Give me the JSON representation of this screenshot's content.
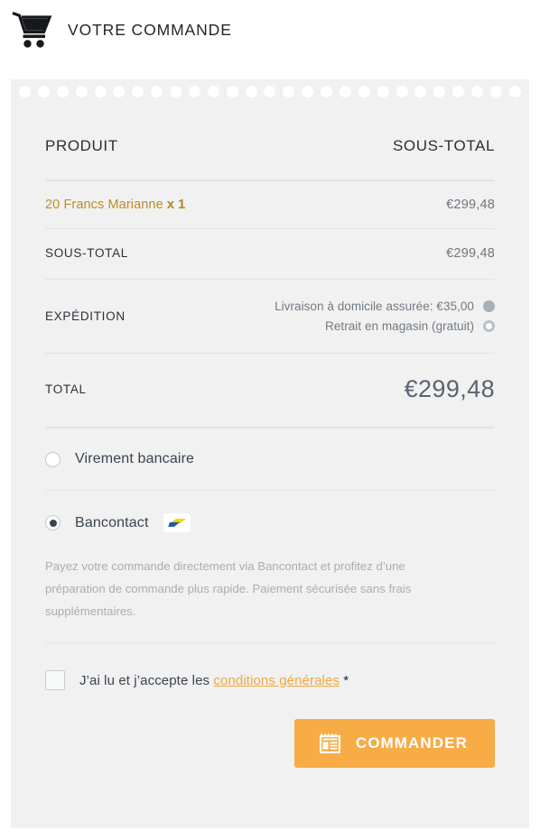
{
  "header": {
    "title": "VOTRE COMMANDE",
    "cart_icon": "shopping-cart-icon"
  },
  "order_table": {
    "columns": {
      "product": "PRODUIT",
      "subtotal": "SOUS-TOTAL"
    },
    "items": [
      {
        "name": "20 Francs Marianne",
        "quantity_label": "x 1",
        "price": "€299,48"
      }
    ],
    "subtotal": {
      "label": "SOUS-TOTAL",
      "value": "€299,48"
    },
    "shipping": {
      "label": "EXPÉDITION",
      "options": [
        {
          "label": "Livraison à domicile assurée: €35,00",
          "selected": true
        },
        {
          "label": "Retrait en magasin (gratuit)",
          "selected": false
        }
      ]
    },
    "total": {
      "label": "TOTAL",
      "value": "€299,48"
    }
  },
  "payment": {
    "methods": [
      {
        "label": "Virement bancaire",
        "selected": false,
        "has_logo": false,
        "description": ""
      },
      {
        "label": "Bancontact",
        "selected": true,
        "has_logo": true,
        "logo_name": "bancontact-logo",
        "description": "Payez votre commande directement via Bancontact et profitez d’une préparation de commande plus rapide. Paiement sécurisée sans frais supplémentaires."
      }
    ]
  },
  "terms": {
    "text_before": "J’ai lu et j’accepte les",
    "link": "conditions générales",
    "required_mark": "*",
    "checked": false
  },
  "order_button": {
    "label": "COMMANDER",
    "icon": "form-document-icon"
  },
  "colors": {
    "accent_orange": "#f7ac45",
    "link_orange": "#f0a73f",
    "product_gold": "#c08b2e",
    "card_background": "#f0f1f0",
    "page_background": "#ffffff",
    "heading_navy": "#2b2f3a",
    "muted_gray": "#a8aeb6",
    "bancontact_blue": "#1a5bb0",
    "bancontact_yellow": "#ffd200"
  }
}
